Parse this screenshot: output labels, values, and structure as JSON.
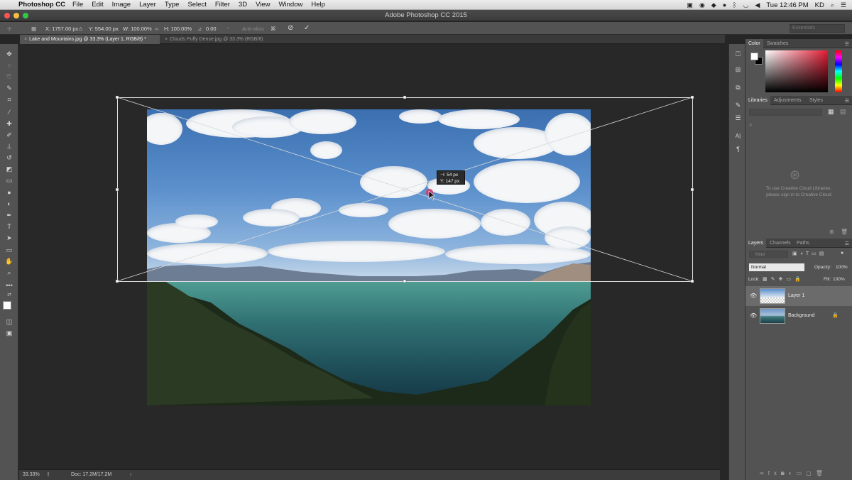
{
  "menubar": {
    "app": "Photoshop CC",
    "items": [
      "File",
      "Edit",
      "Image",
      "Layer",
      "Type",
      "Select",
      "Filter",
      "3D",
      "View",
      "Window",
      "Help"
    ],
    "clock": "Tue 12:46 PM",
    "user": "KD"
  },
  "window": {
    "title": "Adobe Photoshop CC 2015"
  },
  "options": {
    "x": "X: 1757.00 px",
    "y": "Y: 554.00 px",
    "w": "W: 100.00%",
    "h": "H: 100.00%",
    "angle": "0.00",
    "interpolation_label": "°",
    "antialias": "Anti-alias",
    "workspace": "Essentials"
  },
  "tabs": [
    {
      "label": "Lake and Mountains.jpg @ 33.3% (Layer 1, RGB/8) *"
    },
    {
      "label": "Clouds Puffy Dense.jpg @ 33.3% (RGB/8)"
    }
  ],
  "transform_tip": {
    "line1": "⊣: 54 px",
    "line2": "Y: 147 px"
  },
  "status": {
    "zoom": "33.33%",
    "doc": "Doc: 17.2M/17.2M"
  },
  "color_panel": {
    "tabs": [
      "Color",
      "Swatches"
    ],
    "foreground": "#ffffff",
    "background": "#000000",
    "hue": "#e41b34"
  },
  "libraries_panel": {
    "tabs": [
      "Libraries",
      "Adjustments",
      "Styles"
    ],
    "message_line1": "To use Creative Cloud Libraries,",
    "message_line2": "please sign in to Creative Cloud"
  },
  "layers_panel": {
    "tabs": [
      "Layers",
      "Channels",
      "Paths"
    ],
    "filter_placeholder": "Kind",
    "blend_mode": "Normal",
    "opacity_label": "Opacity:",
    "opacity_value": "100%",
    "lock_label": "Lock:",
    "fill_label": "Fill:",
    "fill_value": "100%",
    "layers": [
      {
        "name": "Layer 1",
        "selected": true
      },
      {
        "name": "Background",
        "locked": true
      }
    ]
  }
}
